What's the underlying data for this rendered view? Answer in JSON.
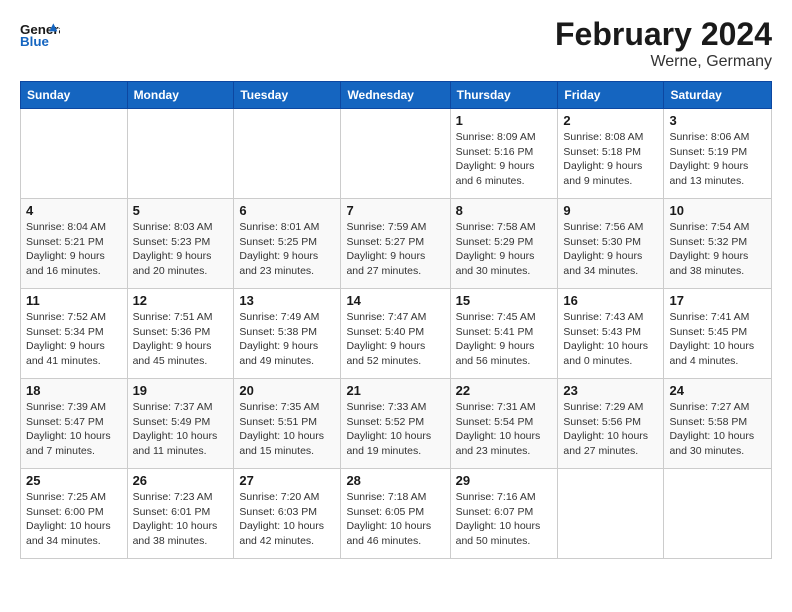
{
  "header": {
    "logo_line1": "General",
    "logo_line2": "Blue",
    "title": "February 2024",
    "subtitle": "Werne, Germany"
  },
  "calendar": {
    "days_of_week": [
      "Sunday",
      "Monday",
      "Tuesday",
      "Wednesday",
      "Thursday",
      "Friday",
      "Saturday"
    ],
    "weeks": [
      [
        {
          "day": "",
          "detail": ""
        },
        {
          "day": "",
          "detail": ""
        },
        {
          "day": "",
          "detail": ""
        },
        {
          "day": "",
          "detail": ""
        },
        {
          "day": "1",
          "detail": "Sunrise: 8:09 AM\nSunset: 5:16 PM\nDaylight: 9 hours\nand 6 minutes."
        },
        {
          "day": "2",
          "detail": "Sunrise: 8:08 AM\nSunset: 5:18 PM\nDaylight: 9 hours\nand 9 minutes."
        },
        {
          "day": "3",
          "detail": "Sunrise: 8:06 AM\nSunset: 5:19 PM\nDaylight: 9 hours\nand 13 minutes."
        }
      ],
      [
        {
          "day": "4",
          "detail": "Sunrise: 8:04 AM\nSunset: 5:21 PM\nDaylight: 9 hours\nand 16 minutes."
        },
        {
          "day": "5",
          "detail": "Sunrise: 8:03 AM\nSunset: 5:23 PM\nDaylight: 9 hours\nand 20 minutes."
        },
        {
          "day": "6",
          "detail": "Sunrise: 8:01 AM\nSunset: 5:25 PM\nDaylight: 9 hours\nand 23 minutes."
        },
        {
          "day": "7",
          "detail": "Sunrise: 7:59 AM\nSunset: 5:27 PM\nDaylight: 9 hours\nand 27 minutes."
        },
        {
          "day": "8",
          "detail": "Sunrise: 7:58 AM\nSunset: 5:29 PM\nDaylight: 9 hours\nand 30 minutes."
        },
        {
          "day": "9",
          "detail": "Sunrise: 7:56 AM\nSunset: 5:30 PM\nDaylight: 9 hours\nand 34 minutes."
        },
        {
          "day": "10",
          "detail": "Sunrise: 7:54 AM\nSunset: 5:32 PM\nDaylight: 9 hours\nand 38 minutes."
        }
      ],
      [
        {
          "day": "11",
          "detail": "Sunrise: 7:52 AM\nSunset: 5:34 PM\nDaylight: 9 hours\nand 41 minutes."
        },
        {
          "day": "12",
          "detail": "Sunrise: 7:51 AM\nSunset: 5:36 PM\nDaylight: 9 hours\nand 45 minutes."
        },
        {
          "day": "13",
          "detail": "Sunrise: 7:49 AM\nSunset: 5:38 PM\nDaylight: 9 hours\nand 49 minutes."
        },
        {
          "day": "14",
          "detail": "Sunrise: 7:47 AM\nSunset: 5:40 PM\nDaylight: 9 hours\nand 52 minutes."
        },
        {
          "day": "15",
          "detail": "Sunrise: 7:45 AM\nSunset: 5:41 PM\nDaylight: 9 hours\nand 56 minutes."
        },
        {
          "day": "16",
          "detail": "Sunrise: 7:43 AM\nSunset: 5:43 PM\nDaylight: 10 hours\nand 0 minutes."
        },
        {
          "day": "17",
          "detail": "Sunrise: 7:41 AM\nSunset: 5:45 PM\nDaylight: 10 hours\nand 4 minutes."
        }
      ],
      [
        {
          "day": "18",
          "detail": "Sunrise: 7:39 AM\nSunset: 5:47 PM\nDaylight: 10 hours\nand 7 minutes."
        },
        {
          "day": "19",
          "detail": "Sunrise: 7:37 AM\nSunset: 5:49 PM\nDaylight: 10 hours\nand 11 minutes."
        },
        {
          "day": "20",
          "detail": "Sunrise: 7:35 AM\nSunset: 5:51 PM\nDaylight: 10 hours\nand 15 minutes."
        },
        {
          "day": "21",
          "detail": "Sunrise: 7:33 AM\nSunset: 5:52 PM\nDaylight: 10 hours\nand 19 minutes."
        },
        {
          "day": "22",
          "detail": "Sunrise: 7:31 AM\nSunset: 5:54 PM\nDaylight: 10 hours\nand 23 minutes."
        },
        {
          "day": "23",
          "detail": "Sunrise: 7:29 AM\nSunset: 5:56 PM\nDaylight: 10 hours\nand 27 minutes."
        },
        {
          "day": "24",
          "detail": "Sunrise: 7:27 AM\nSunset: 5:58 PM\nDaylight: 10 hours\nand 30 minutes."
        }
      ],
      [
        {
          "day": "25",
          "detail": "Sunrise: 7:25 AM\nSunset: 6:00 PM\nDaylight: 10 hours\nand 34 minutes."
        },
        {
          "day": "26",
          "detail": "Sunrise: 7:23 AM\nSunset: 6:01 PM\nDaylight: 10 hours\nand 38 minutes."
        },
        {
          "day": "27",
          "detail": "Sunrise: 7:20 AM\nSunset: 6:03 PM\nDaylight: 10 hours\nand 42 minutes."
        },
        {
          "day": "28",
          "detail": "Sunrise: 7:18 AM\nSunset: 6:05 PM\nDaylight: 10 hours\nand 46 minutes."
        },
        {
          "day": "29",
          "detail": "Sunrise: 7:16 AM\nSunset: 6:07 PM\nDaylight: 10 hours\nand 50 minutes."
        },
        {
          "day": "",
          "detail": ""
        },
        {
          "day": "",
          "detail": ""
        }
      ]
    ]
  }
}
